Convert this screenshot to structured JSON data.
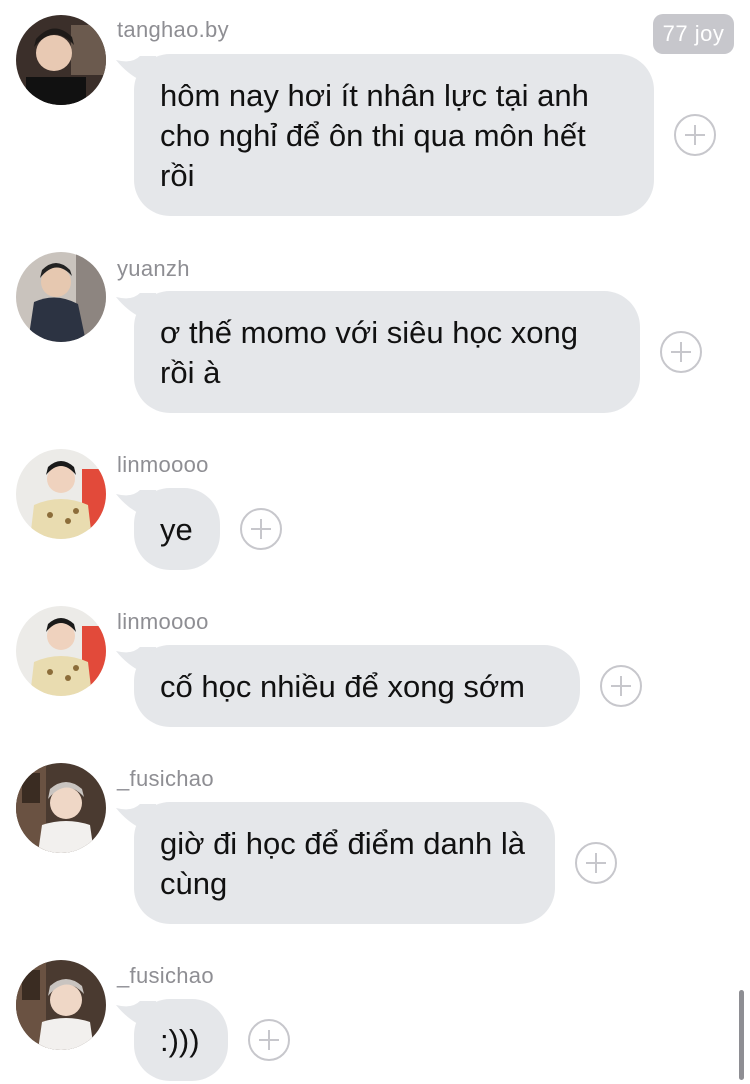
{
  "badge": {
    "label": "77 joy"
  },
  "messages": [
    {
      "username": "tanghao.by",
      "text": "hôm nay hơi ít nhân lực tại anh cho nghỉ để ôn thi qua môn hết rồi"
    },
    {
      "username": "yuanzh",
      "text": "ơ thế momo với siêu học xong rồi à"
    },
    {
      "username": "linmoooo",
      "text": "ye"
    },
    {
      "username": "linmoooo",
      "text": "cố học nhiều để xong sớm"
    },
    {
      "username": "_fusichao",
      "text": "giờ đi học để điểm danh là cùng"
    },
    {
      "username": "_fusichao",
      "text": ":)))"
    }
  ],
  "colors": {
    "bubble": "#e5e7ea",
    "username": "#8e8e93",
    "text": "#111111",
    "add_icon": "#c7c7cc"
  },
  "icons": {
    "reaction": "add-reaction-icon",
    "avatar": "avatar"
  }
}
